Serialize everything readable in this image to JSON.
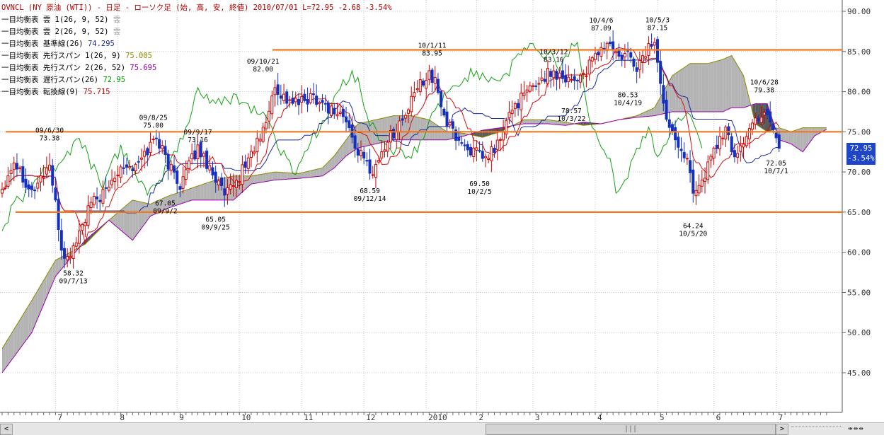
{
  "legend": {
    "header": "OVNCL (NY 原油 (WTI)) - 日足 - ローソク足 (始, 高, 安, 終値)  2010/07/01 L=72.95 -2.68  -3.54%",
    "rows": [
      {
        "label": "一目均衡表 雲 1(26, 9, 52)",
        "value": "雲",
        "color": "#a0a0a0"
      },
      {
        "label": "一目均衡表 雲 2(26, 9, 52)",
        "value": "雲",
        "color": "#a0a0a0"
      },
      {
        "label": "一目均衡表 基準線(26)",
        "value": "74.295",
        "color": "#1c2aa0"
      },
      {
        "label": "一目均衡表 先行スパン 1(26, 9)",
        "value": "75.005",
        "color": "#8a8a00"
      },
      {
        "label": "一目均衡表 先行スパン 2(26, 52)",
        "value": "75.695",
        "color": "#9a00b0"
      },
      {
        "label": "一目均衡表 遅行スパン(26)",
        "value": "72.95",
        "color": "#009a00"
      },
      {
        "label": "一目均衡表 転換線(9)",
        "value": "75.715",
        "color": "#c00000"
      }
    ]
  },
  "price_badge": {
    "price": "72.95",
    "change": "-3.54%"
  },
  "scrollbar": {
    "left_arrow": "<",
    "right_arrow": ">",
    "thumb_grip": "|||",
    "zoom_buttons": "⇹⇹⇹"
  },
  "colors": {
    "up_candle": "#d00000",
    "down_candle": "#1530c0",
    "kumo_fill": "#b4b4b4",
    "kumo_dark": "#5a5a5a",
    "horizontal_line": "#f07820",
    "grid": "#c8c8c8",
    "axis_text": "#333333"
  },
  "chart_data": {
    "type": "candlestick",
    "title": "OVNCL (NY 原油 (WTI)) - 日足 - ローソク足 (始, 高, 安, 終値)",
    "ylim": [
      40.0,
      92.0
    ],
    "y_ticks": [
      {
        "v": 90,
        "label": "90.00"
      },
      {
        "v": 85,
        "label": "85.00"
      },
      {
        "v": 80,
        "label": "80.00"
      },
      {
        "v": 75,
        "label": "75.00"
      },
      {
        "v": 70,
        "label": "70.00"
      },
      {
        "v": 65,
        "label": "65.00"
      },
      {
        "v": 60,
        "label": "60.00"
      },
      {
        "v": 55,
        "label": "55.00"
      },
      {
        "v": 50,
        "label": "50.00"
      },
      {
        "v": 45,
        "label": "45.00"
      }
    ],
    "x_days": 278,
    "x_ticks": [
      {
        "i": 18,
        "label": "7"
      },
      {
        "i": 39,
        "label": "8"
      },
      {
        "i": 59,
        "label": "9"
      },
      {
        "i": 80,
        "label": "10"
      },
      {
        "i": 101,
        "label": "11"
      },
      {
        "i": 122,
        "label": "12"
      },
      {
        "i": 143,
        "label": "2010"
      },
      {
        "i": 160,
        "label": "2"
      },
      {
        "i": 179,
        "label": "3"
      },
      {
        "i": 200,
        "label": "4"
      },
      {
        "i": 221,
        "label": "5"
      },
      {
        "i": 240,
        "label": "6"
      },
      {
        "i": 261,
        "label": "7"
      }
    ],
    "close_anchors": [
      [
        0,
        68.0
      ],
      [
        4,
        71.5
      ],
      [
        10,
        67.5
      ],
      [
        16,
        71.0
      ],
      [
        20,
        60.5
      ],
      [
        22,
        59.0
      ],
      [
        25,
        61.5
      ],
      [
        30,
        66.0
      ],
      [
        35,
        67.5
      ],
      [
        40,
        71.0
      ],
      [
        45,
        70.5
      ],
      [
        52,
        74.5
      ],
      [
        56,
        71.0
      ],
      [
        60,
        68.5
      ],
      [
        66,
        73.0
      ],
      [
        71,
        70.0
      ],
      [
        75,
        67.0
      ],
      [
        78,
        68.0
      ],
      [
        82,
        71.0
      ],
      [
        88,
        75.0
      ],
      [
        92,
        80.5
      ],
      [
        96,
        79.0
      ],
      [
        100,
        78.5
      ],
      [
        105,
        79.5
      ],
      [
        110,
        78.0
      ],
      [
        115,
        77.0
      ],
      [
        120,
        72.5
      ],
      [
        125,
        70.0
      ],
      [
        130,
        74.0
      ],
      [
        136,
        77.0
      ],
      [
        140,
        80.5
      ],
      [
        144,
        82.5
      ],
      [
        146,
        81.0
      ],
      [
        150,
        76.0
      ],
      [
        155,
        73.5
      ],
      [
        159,
        72.5
      ],
      [
        163,
        71.5
      ],
      [
        168,
        74.0
      ],
      [
        172,
        78.0
      ],
      [
        176,
        79.5
      ],
      [
        180,
        81.0
      ],
      [
        185,
        82.5
      ],
      [
        189,
        82.0
      ],
      [
        193,
        81.5
      ],
      [
        197,
        82.5
      ],
      [
        201,
        85.0
      ],
      [
        205,
        86.0
      ],
      [
        208,
        84.0
      ],
      [
        211,
        84.5
      ],
      [
        214,
        83.0
      ],
      [
        218,
        85.5
      ],
      [
        220,
        86.5
      ],
      [
        223,
        78.0
      ],
      [
        227,
        74.5
      ],
      [
        230,
        72.5
      ],
      [
        233,
        68.0
      ],
      [
        236,
        68.5
      ],
      [
        240,
        73.0
      ],
      [
        244,
        75.0
      ],
      [
        247,
        72.0
      ],
      [
        251,
        74.5
      ],
      [
        255,
        77.0
      ],
      [
        258,
        77.5
      ],
      [
        260,
        75.5
      ],
      [
        262,
        72.95
      ]
    ],
    "kumo": [
      [
        0,
        48.0,
        45.0
      ],
      [
        10,
        54.0,
        50.0
      ],
      [
        18,
        59.0,
        57.0
      ],
      [
        28,
        61.0,
        61.5
      ],
      [
        36,
        64.0,
        64.0
      ],
      [
        44,
        66.5,
        61.5
      ],
      [
        50,
        66.0,
        64.5
      ],
      [
        56,
        67.0,
        65.5
      ],
      [
        64,
        68.0,
        66.5
      ],
      [
        72,
        69.0,
        66.5
      ],
      [
        78,
        69.5,
        66.5
      ],
      [
        84,
        69.5,
        68.5
      ],
      [
        92,
        70.0,
        69.0
      ],
      [
        100,
        69.8,
        69.2
      ],
      [
        108,
        70.5,
        69.5
      ],
      [
        112,
        72.0,
        70.5
      ],
      [
        116,
        74.0,
        72.0
      ],
      [
        120,
        76.0,
        73.0
      ],
      [
        126,
        76.5,
        73.5
      ],
      [
        132,
        77.0,
        74.0
      ],
      [
        138,
        77.0,
        74.0
      ],
      [
        144,
        76.5,
        74.0
      ],
      [
        150,
        75.0,
        74.0
      ],
      [
        156,
        74.8,
        74.5
      ],
      [
        162,
        74.3,
        75.2
      ],
      [
        168,
        75.0,
        75.5
      ],
      [
        176,
        76.5,
        76.0
      ],
      [
        184,
        76.5,
        76.0
      ],
      [
        190,
        76.2,
        75.8
      ],
      [
        196,
        75.8,
        76.2
      ],
      [
        202,
        76.0,
        76.0
      ],
      [
        208,
        76.5,
        76.5
      ],
      [
        214,
        77.0,
        76.8
      ],
      [
        220,
        78.0,
        77.0
      ],
      [
        226,
        82.0,
        77.5
      ],
      [
        232,
        83.5,
        77.5
      ],
      [
        238,
        83.5,
        77.5
      ],
      [
        243,
        84.0,
        77.5
      ],
      [
        246,
        84.5,
        78.0
      ],
      [
        250,
        82.0,
        78.0
      ],
      [
        254,
        76.0,
        78.5
      ],
      [
        258,
        75.0,
        78.5
      ],
      [
        262,
        75.5,
        74.0
      ],
      [
        266,
        75.0,
        73.5
      ],
      [
        270,
        75.5,
        72.5
      ],
      [
        274,
        75.5,
        74.5
      ],
      [
        278,
        75.5,
        75.3
      ]
    ],
    "horizontal_lines": [
      85.2,
      75.0,
      65.0
    ],
    "annotations": [
      {
        "i": 24,
        "v": 58.32,
        "text": [
          "58.32",
          "09/7/13"
        ],
        "pos": "below"
      },
      {
        "i": 16,
        "v": 73.38,
        "text": [
          "09/6/30",
          "73.38"
        ],
        "pos": "above"
      },
      {
        "i": 51,
        "v": 75.0,
        "text": [
          "09/8/25",
          "75.00"
        ],
        "pos": "above"
      },
      {
        "i": 55,
        "v": 67.05,
        "text": [
          "67.05",
          "09/9/2"
        ],
        "pos": "below"
      },
      {
        "i": 66,
        "v": 73.16,
        "text": [
          "09/9/17",
          "73.16"
        ],
        "pos": "above"
      },
      {
        "i": 72,
        "v": 65.05,
        "text": [
          "65.05",
          "09/9/25"
        ],
        "pos": "below"
      },
      {
        "i": 88,
        "v": 82.0,
        "text": [
          "09/10/21",
          "82.00"
        ],
        "pos": "above"
      },
      {
        "i": 124,
        "v": 68.59,
        "text": [
          "68.59",
          "09/12/14"
        ],
        "pos": "below"
      },
      {
        "i": 145,
        "v": 83.95,
        "text": [
          "10/1/11",
          "83.95"
        ],
        "pos": "above"
      },
      {
        "i": 161,
        "v": 69.5,
        "text": [
          "69.50",
          "10/2/5"
        ],
        "pos": "below"
      },
      {
        "i": 186,
        "v": 83.16,
        "text": [
          "10/3/12",
          "83.16"
        ],
        "pos": "above"
      },
      {
        "i": 192,
        "v": 78.57,
        "text": [
          "78.57",
          "10/3/22"
        ],
        "pos": "below"
      },
      {
        "i": 202,
        "v": 87.09,
        "text": [
          "10/4/6",
          "87.09"
        ],
        "pos": "above"
      },
      {
        "i": 211,
        "v": 80.53,
        "text": [
          "80.53",
          "10/4/19"
        ],
        "pos": "below"
      },
      {
        "i": 221,
        "v": 87.15,
        "text": [
          "10/5/3",
          "87.15"
        ],
        "pos": "above"
      },
      {
        "i": 233,
        "v": 64.24,
        "text": [
          "64.24",
          "10/5/20"
        ],
        "pos": "below"
      },
      {
        "i": 257,
        "v": 79.38,
        "text": [
          "10/6/28",
          "79.38"
        ],
        "pos": "above"
      },
      {
        "i": 261,
        "v": 72.05,
        "text": [
          "72.05",
          "10/7/1"
        ],
        "pos": "below"
      }
    ]
  }
}
